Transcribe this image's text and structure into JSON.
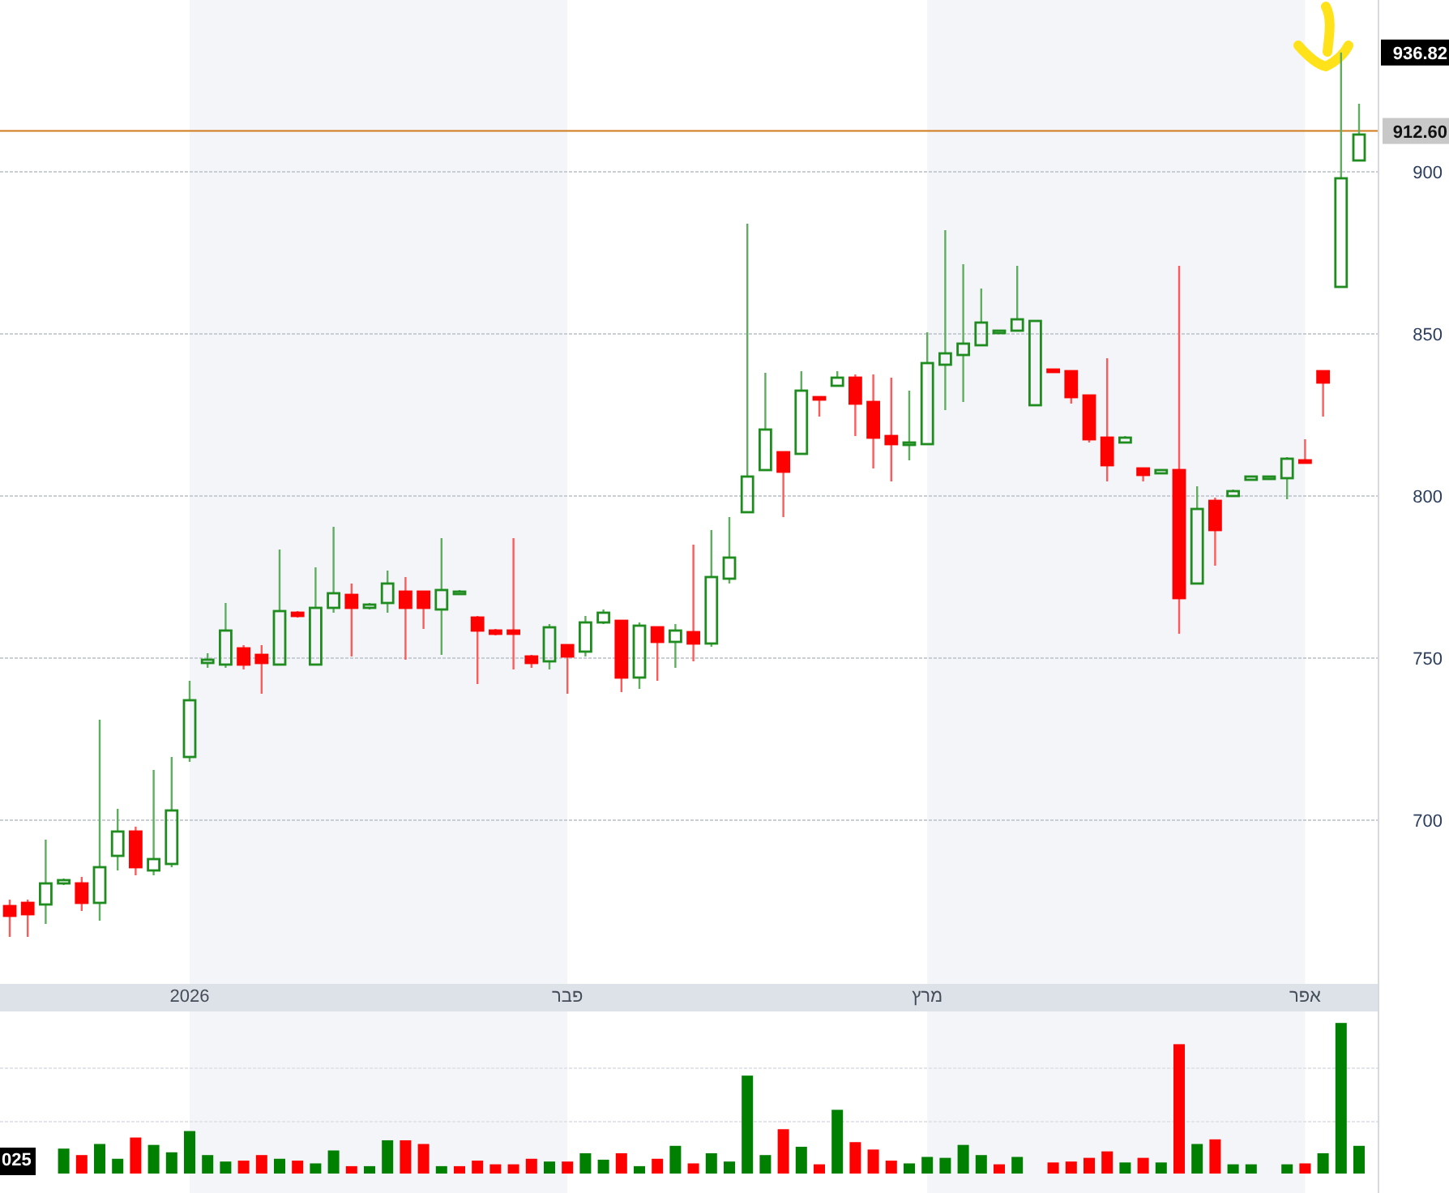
{
  "chart": {
    "chart_data": {
      "type": "candlestick",
      "categories": [
        null,
        null,
        null,
        null,
        null,
        null,
        null,
        null,
        null,
        null,
        "2026",
        null,
        null,
        null,
        null,
        null,
        null,
        null,
        null,
        null,
        null,
        null,
        null,
        null,
        null,
        null,
        null,
        null,
        null,
        null,
        null,
        "פבר",
        null,
        null,
        null,
        null,
        null,
        null,
        null,
        null,
        null,
        null,
        null,
        null,
        null,
        null,
        null,
        null,
        null,
        null,
        null,
        "מרץ",
        null,
        null,
        null,
        null,
        null,
        null,
        null,
        null,
        null,
        null,
        null,
        null,
        null,
        null,
        null,
        null,
        null,
        null,
        null,
        null,
        "אפר",
        null,
        null,
        null
      ],
      "ohlc": [
        [
          673.5,
          675.5,
          664,
          670.5
        ],
        [
          674.5,
          675.5,
          664,
          671
        ],
        [
          674,
          694,
          668,
          680.5
        ],
        [
          680.5,
          682,
          680,
          681.5
        ],
        [
          680.5,
          682.5,
          672,
          674.5
        ],
        [
          674.5,
          731,
          669,
          685.5
        ],
        [
          689,
          703.5,
          684.5,
          696.5
        ],
        [
          696.5,
          698,
          683,
          685.5
        ],
        [
          684.5,
          715.5,
          683,
          688
        ],
        [
          686.5,
          719.5,
          685.5,
          703
        ],
        [
          719.5,
          743,
          718,
          737
        ],
        [
          748.5,
          751.5,
          747,
          749.5
        ],
        [
          748,
          767,
          747,
          758.5
        ],
        [
          753,
          754,
          746.5,
          748
        ],
        [
          751,
          754,
          739,
          748.5
        ],
        [
          748,
          783.5,
          748,
          764.5
        ],
        [
          764,
          764.5,
          762.5,
          763
        ],
        [
          748,
          778,
          748,
          765.5
        ],
        [
          765.5,
          790.5,
          764,
          770
        ],
        [
          769.5,
          773,
          750.5,
          765.5
        ],
        [
          765.5,
          767,
          765,
          766.5
        ],
        [
          767,
          777,
          764,
          773
        ],
        [
          770.5,
          775,
          749.5,
          765.5
        ],
        [
          770.5,
          770.5,
          759,
          765.5
        ],
        [
          765,
          787,
          751,
          771
        ],
        [
          770,
          771,
          769.5,
          770.5
        ],
        [
          762.5,
          763,
          742,
          758.5
        ],
        [
          758.5,
          759,
          757,
          757.5
        ],
        [
          758.5,
          787,
          746.5,
          757.5
        ],
        [
          750.5,
          751,
          747,
          748.5
        ],
        [
          749,
          760.5,
          746.5,
          759.5
        ],
        [
          754,
          754,
          739,
          750.5
        ],
        [
          752,
          763,
          750.5,
          761
        ],
        [
          761,
          765,
          760.5,
          764
        ],
        [
          761.5,
          761.5,
          739.5,
          744
        ],
        [
          744,
          761,
          740.5,
          760
        ],
        [
          759.5,
          759.5,
          743,
          755
        ],
        [
          755,
          760.5,
          747,
          758.5
        ],
        [
          758,
          785,
          749,
          754.5
        ],
        [
          754.5,
          789.5,
          753.5,
          775
        ],
        [
          774.5,
          793.5,
          773,
          781
        ],
        [
          795,
          884,
          795,
          806
        ],
        [
          808,
          838,
          808,
          820.5
        ],
        [
          813.5,
          813.5,
          793.5,
          807.5
        ],
        [
          813,
          838.5,
          813,
          832.5
        ],
        [
          830.5,
          830.5,
          824.5,
          830
        ],
        [
          834,
          838.5,
          834,
          836.5
        ],
        [
          836.5,
          837.5,
          818.5,
          828.5
        ],
        [
          829,
          837.5,
          808.5,
          818
        ],
        [
          818.5,
          836.5,
          804.5,
          816
        ],
        [
          816,
          832.5,
          811,
          816.5
        ],
        [
          816,
          850.5,
          816,
          841
        ],
        [
          840.5,
          882,
          826.5,
          844
        ],
        [
          843.5,
          871.5,
          829,
          847
        ],
        [
          846.5,
          864,
          846.5,
          853.5
        ],
        [
          850.5,
          851,
          850.5,
          851
        ],
        [
          851,
          871,
          851,
          854.5
        ],
        [
          828,
          854,
          828,
          854
        ],
        [
          839,
          839,
          838.5,
          838.5
        ],
        [
          838.5,
          838.5,
          828.5,
          830.5
        ],
        [
          831,
          831,
          816.5,
          817.5
        ],
        [
          818,
          842.5,
          804.5,
          809.5
        ],
        [
          816.5,
          818.5,
          816.5,
          818
        ],
        [
          808.5,
          808.5,
          804.5,
          806.5
        ],
        [
          807,
          808,
          807,
          808
        ],
        [
          808,
          871,
          757.5,
          768.5
        ],
        [
          773,
          803,
          773,
          796
        ],
        [
          798.5,
          799.5,
          778.5,
          789.5
        ],
        [
          800,
          802,
          800,
          801.5
        ],
        [
          805,
          806,
          805,
          806
        ],
        [
          805.5,
          806,
          805.5,
          806
        ],
        [
          805.5,
          812,
          799,
          811.5
        ],
        [
          811,
          817.5,
          810.5,
          810.5
        ],
        [
          838.5,
          838.5,
          824.5,
          835
        ],
        [
          864.5,
          936.8,
          864.5,
          898
        ],
        [
          903.5,
          921,
          903.5,
          911.5
        ]
      ],
      "ylim": [
        649.5,
        953
      ],
      "yticks": [
        700,
        750,
        800,
        850,
        900
      ],
      "grid": true,
      "ref_lines": [
        {
          "axis": "y",
          "value": 912.6,
          "label": "912.60",
          "color": "#d07a1c"
        }
      ],
      "annotations": [
        "936.82"
      ]
    }
  },
  "volume": {
    "label": "025"
  }
}
